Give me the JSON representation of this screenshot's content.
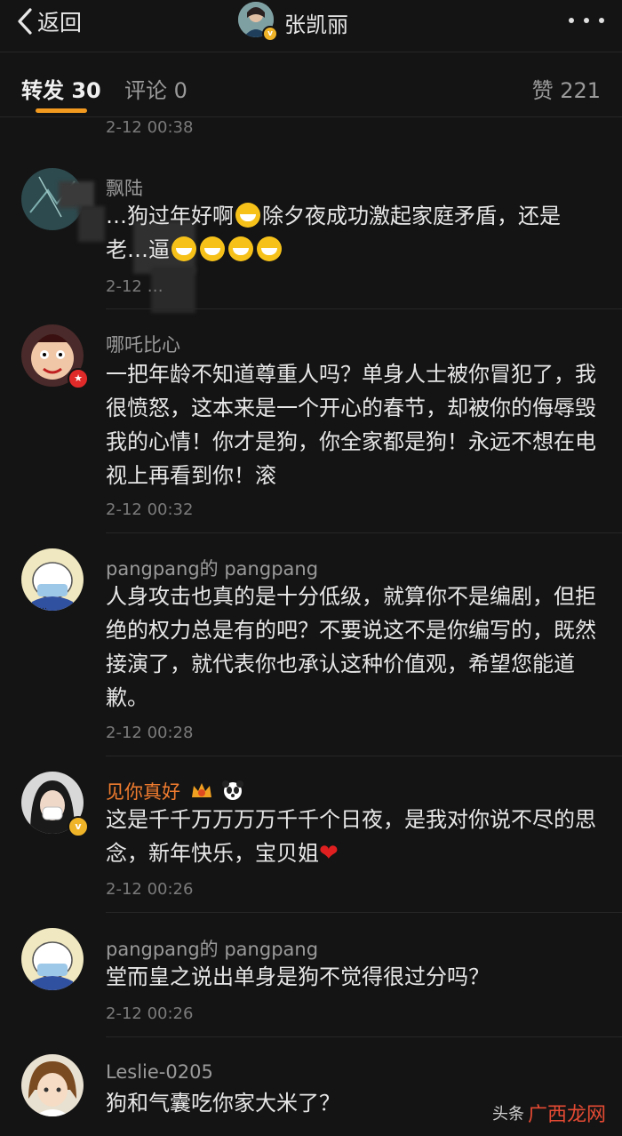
{
  "header": {
    "back_label": "返回",
    "title": "张凯丽",
    "avatar_icon": "verified-user-avatar",
    "more_icon": "more-dots-icon"
  },
  "tabs": {
    "repost": "转发 30",
    "comment": "评论 0",
    "like": "赞 221",
    "active_color": "#f29a20"
  },
  "prev_time": "2-12 00:38",
  "comments": [
    {
      "name": "飘陆",
      "text_a": "…狗过年好啊",
      "text_b": "除夕夜成功激起家庭矛盾，还是",
      "text_c": "老…逼",
      "time": "2-12 …"
    },
    {
      "name": "哪吒比心",
      "text": "一把年龄不知道尊重人吗？单身人士被你冒犯了，我很愤怒，这本来是一个开心的春节，却被你的侮辱毁我的心情！你才是狗，你全家都是狗！永远不想在电视上再看到你！滚",
      "time": "2-12 00:32"
    },
    {
      "name": "pangpang的 pangpang",
      "text": "人身攻击也真的是十分低级，就算你不是编剧，但拒绝的权力总是有的吧？不要说这不是你编写的，既然接演了，就代表你也承认这种价值观，希望您能道歉。",
      "time": "2-12 00:28"
    },
    {
      "name": "见你真好",
      "text": "这是千千万万万万千千个日夜，是我对你说不尽的思念，新年快乐，宝贝姐",
      "time": "2-12 00:26"
    },
    {
      "name": "pangpang的 pangpang",
      "text": "堂而皇之说出单身是狗不觉得很过分吗？",
      "time": "2-12 00:26"
    },
    {
      "name": "Leslie-0205",
      "text": "狗和气囊吃你家大米了？"
    }
  ],
  "watermark": {
    "prefix": "头条",
    "brand": "广西龙网"
  },
  "colors": {
    "background": "#141414",
    "orange_name": "#f07c2f",
    "heart": "#e02020"
  }
}
